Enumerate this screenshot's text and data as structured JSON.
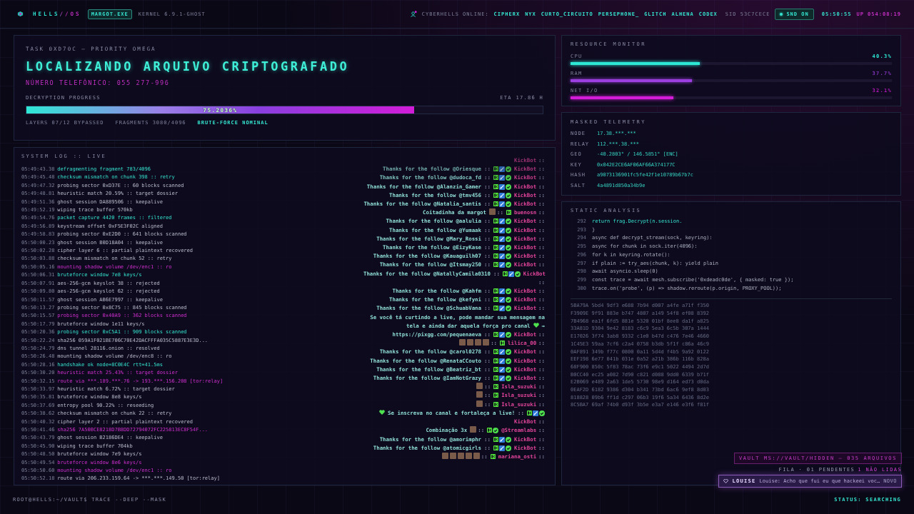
{
  "top_bar": {
    "brand": "HELLS//OS",
    "process": "MARGOT.EXE",
    "kernel": "KERNEL 6.9.1-GHOST",
    "online_label": "CYBERHELLS ONLINE:",
    "online_users": [
      "CIPHERX",
      "NYX",
      "CURTO_CIRCUITO",
      "PERSEPHONE_",
      "GLITCH",
      "ALHENA",
      "CODEX"
    ],
    "sid": "SID 53C7CECE",
    "sound": {
      "label": "SND ON",
      "on": true
    },
    "clock": "05:50:55",
    "uptime": "UP 054:08:19"
  },
  "task": {
    "label": "TASK 0XD70C — PRIORITY OMEGA",
    "title": "LOCALIZANDO ARQUIVO CRIPTOGRAFADO",
    "phone": "NÚMERO TELEFÔNICO: 055 277-996",
    "progress_label": "DECRYPTION PROGRESS",
    "eta": "ETA 17.86 H",
    "progress": {
      "level": 0.751,
      "reading": "75.2036%"
    },
    "stats": [
      {
        "text": "LAYERS 07/12 BYPASSED",
        "kind": "plain"
      },
      {
        "text": "FRAGMENTS 3080/4096",
        "kind": "plain"
      },
      {
        "text": "BRUTE-FORCE NOMINAL",
        "kind": "ok"
      }
    ]
  },
  "system_log": {
    "title": "SYSTEM LOG :: LIVE",
    "lines": [
      {
        "time": "05:49:43.38",
        "text": "defragmenting fragment 783/4096",
        "kind": "ok"
      },
      {
        "time": "05:49:45.48",
        "text": "checksum mismatch on chunk 398 :: retry",
        "kind": "ok"
      },
      {
        "time": "05:49:47.32",
        "text": "probing sector 0xD37E :: 60 blocks scanned",
        "kind": "plain"
      },
      {
        "time": "05:49:48.81",
        "text": "heuristic match 20.59% :: target dossier",
        "kind": "plain"
      },
      {
        "time": "05:49:51.36",
        "text": "ghost session DA889506 :: keepalive",
        "kind": "plain"
      },
      {
        "time": "05:49:52.19",
        "text": "wiping trace buffer 570kb",
        "kind": "plain"
      },
      {
        "time": "05:49:54.76",
        "text": "packet capture 4420 frames :: filtered",
        "kind": "ok"
      },
      {
        "time": "05:49:56.89",
        "text": "keystream offset 0xF5E3F02C aligned",
        "kind": "plain"
      },
      {
        "time": "05:49:58.83",
        "text": "probing sector 0xE2D0 :: 641 blocks scanned",
        "kind": "plain"
      },
      {
        "time": "05:50:00.23",
        "text": "ghost session B0D18A04 :: keepalive",
        "kind": "plain"
      },
      {
        "time": "05:50:02.28",
        "text": "cipher layer 6 :: partial plaintext recovered",
        "kind": "plain"
      },
      {
        "time": "05:50:03.88",
        "text": "checksum mismatch on chunk 52 :: retry",
        "kind": "plain"
      },
      {
        "time": "05:50:05.16",
        "text": "mounting shadow volume /dev/enc1 :: ro",
        "kind": "alert"
      },
      {
        "time": "05:50:06.31",
        "text": "bruteforce window 7e8 keys/s",
        "kind": "ok"
      },
      {
        "time": "05:50:07.91",
        "text": "aes-256-gcm keyslot 38 :: rejected",
        "kind": "plain"
      },
      {
        "time": "05:50:09.80",
        "text": "aes-256-gcm keyslot 62 :: rejected",
        "kind": "plain"
      },
      {
        "time": "05:50:11.57",
        "text": "ghost session AB6E7997 :: keepalive",
        "kind": "plain"
      },
      {
        "time": "05:50:13.27",
        "text": "probing sector 0x8C75 :: 845 blocks scanned",
        "kind": "plain"
      },
      {
        "time": "05:50:15.57",
        "text": "probing sector 0x40A9 :: 362 blocks scanned",
        "kind": "alert"
      },
      {
        "time": "05:50:17.79",
        "text": "bruteforce window 1e11 keys/s",
        "kind": "plain"
      },
      {
        "time": "05:50:20.36",
        "text": "probing sector 0xC5A1 :: 909 blocks scanned",
        "kind": "ok"
      },
      {
        "time": "05:50:22.24",
        "text": "sha256 059A1F021BE706C70E42DACFFFA035C5887E3E3D...",
        "kind": "plain"
      },
      {
        "time": "05:50:24.79",
        "text": "dns tunnel 28116.onion :: resolved",
        "kind": "plain"
      },
      {
        "time": "05:50:26.48",
        "text": "mounting shadow volume /dev/enc8 :: ro",
        "kind": "plain"
      },
      {
        "time": "05:50:28.16",
        "text": "handshake ok node=8C0E4C rtt=41.5ms",
        "kind": "ok"
      },
      {
        "time": "05:50:30.20",
        "text": "heuristic match 25.43% :: target dossier",
        "kind": "alert"
      },
      {
        "time": "05:50:32.15",
        "text": "route via ***.189.***.76 -> 193.***.156.208 [tor:relay]",
        "kind": "alert"
      },
      {
        "time": "05:50:33.97",
        "text": "heuristic match 6.72% :: target dossier",
        "kind": "plain"
      },
      {
        "time": "05:50:35.81",
        "text": "bruteforce window 8e8 keys/s",
        "kind": "plain"
      },
      {
        "time": "05:50:37.69",
        "text": "entropy pool 90.22% :: reseeding",
        "kind": "plain"
      },
      {
        "time": "05:50:38.62",
        "text": "checksum mismatch on chunk 22 :: retry",
        "kind": "plain"
      },
      {
        "time": "05:50:40.32",
        "text": "cipher layer 2 :: partial plaintext recovered",
        "kind": "plain"
      },
      {
        "time": "05:50:41.46",
        "text": "sha256 7A50BCE8218D7B8DD72794072FC225813EC8F54F...",
        "kind": "alert"
      },
      {
        "time": "05:50:43.79",
        "text": "ghost session B2186DE4 :: keepalive",
        "kind": "plain"
      },
      {
        "time": "05:50:45.90",
        "text": "wiping trace buffer 704kb",
        "kind": "plain"
      },
      {
        "time": "05:50:48.50",
        "text": "bruteforce window 7e9 keys/s",
        "kind": "plain"
      },
      {
        "time": "05:50:49.54",
        "text": "bruteforce window 8e6 keys/s",
        "kind": "alert"
      },
      {
        "time": "05:50:50.60",
        "text": "mounting shadow volume /dev/enc1 :: ro",
        "kind": "alert"
      },
      {
        "time": "05:50:52.18",
        "text": "route via 206.233.159.64 -> ***.***.149.50 [tor:relay]",
        "kind": "plain"
      }
    ]
  },
  "chat": [
    {
      "user": "KickBot",
      "tail": "::"
    },
    {
      "parts": [
        {
          "kind": "text",
          "text": "Thanks for the follow @Oriesque"
        },
        {
          "kind": "sep",
          "text": "::"
        }
      ],
      "badges": [
        {
          "kind": "kick"
        },
        {
          "kind": "sword"
        },
        {
          "kind": "verified"
        }
      ],
      "user": "KickBot",
      "tail": "::"
    },
    {
      "parts": [
        {
          "kind": "text",
          "text": "Thanks for the follow @dudoca_fd"
        },
        {
          "kind": "sep",
          "text": "::"
        }
      ],
      "badges": [
        {
          "kind": "kick"
        },
        {
          "kind": "sword"
        },
        {
          "kind": "verified"
        }
      ],
      "user": "KickBot",
      "tail": "::"
    },
    {
      "parts": [
        {
          "kind": "text",
          "text": "Thanks for the follow @Alanzin_Gamer"
        },
        {
          "kind": "sep",
          "text": "::"
        }
      ],
      "badges": [
        {
          "kind": "kick"
        },
        {
          "kind": "sword"
        },
        {
          "kind": "verified"
        }
      ],
      "user": "KickBot",
      "tail": "::"
    },
    {
      "parts": [
        {
          "kind": "text",
          "text": "Thanks for the follow @tmv456"
        },
        {
          "kind": "sep",
          "text": "::"
        }
      ],
      "badges": [
        {
          "kind": "kick"
        },
        {
          "kind": "sword"
        },
        {
          "kind": "verified"
        }
      ],
      "user": "KickBot",
      "tail": "::"
    },
    {
      "parts": [
        {
          "kind": "text",
          "text": "Thanks for the follow @Natalia_santis"
        },
        {
          "kind": "sep",
          "text": "::"
        }
      ],
      "badges": [
        {
          "kind": "kick"
        },
        {
          "kind": "sword"
        },
        {
          "kind": "verified"
        }
      ],
      "user": "KickBot",
      "tail": "::"
    },
    {
      "parts": [
        {
          "kind": "text",
          "text": "Coitadinha da margot"
        },
        {
          "kind": "emote"
        },
        {
          "kind": "sep",
          "text": "::"
        }
      ],
      "badges": [
        {
          "kind": "kick"
        }
      ],
      "user": "buenosn",
      "tail": "::"
    },
    {
      "parts": [
        {
          "kind": "text",
          "text": "Thanks for the follow @aalulia"
        },
        {
          "kind": "sep",
          "text": "::"
        }
      ],
      "badges": [
        {
          "kind": "kick"
        },
        {
          "kind": "sword"
        },
        {
          "kind": "verified"
        }
      ],
      "user": "KickBot",
      "tail": "::"
    },
    {
      "parts": [
        {
          "kind": "text",
          "text": "Thanks for the follow @Yumaak"
        },
        {
          "kind": "sep",
          "text": "::"
        }
      ],
      "badges": [
        {
          "kind": "kick"
        },
        {
          "kind": "sword"
        },
        {
          "kind": "verified"
        }
      ],
      "user": "KickBot",
      "tail": "::"
    },
    {
      "parts": [
        {
          "kind": "text",
          "text": "Thanks for the follow @Mary_Rossi"
        },
        {
          "kind": "sep",
          "text": "::"
        }
      ],
      "badges": [
        {
          "kind": "kick"
        },
        {
          "kind": "sword"
        },
        {
          "kind": "verified"
        }
      ],
      "user": "KickBot",
      "tail": "::"
    },
    {
      "parts": [
        {
          "kind": "text",
          "text": "Thanks for the follow @EizyKase"
        },
        {
          "kind": "sep",
          "text": "::"
        }
      ],
      "badges": [
        {
          "kind": "kick"
        },
        {
          "kind": "sword"
        },
        {
          "kind": "verified"
        }
      ],
      "user": "KickBot",
      "tail": "::"
    },
    {
      "parts": [
        {
          "kind": "text",
          "text": "Thanks for the follow @Kauaguilh07"
        },
        {
          "kind": "sep",
          "text": "::"
        }
      ],
      "badges": [
        {
          "kind": "kick"
        },
        {
          "kind": "sword"
        },
        {
          "kind": "verified"
        }
      ],
      "user": "KickBot",
      "tail": "::"
    },
    {
      "parts": [
        {
          "kind": "text",
          "text": "Thanks for the follow @Itsmay250"
        },
        {
          "kind": "sep",
          "text": "::"
        }
      ],
      "badges": [
        {
          "kind": "kick"
        },
        {
          "kind": "sword"
        },
        {
          "kind": "verified"
        }
      ],
      "user": "KickBot",
      "tail": "::"
    },
    {
      "parts": [
        {
          "kind": "text",
          "text": "Thanks for the follow @NatallyCamila0310"
        },
        {
          "kind": "sep",
          "text": "::"
        }
      ],
      "badges": [
        {
          "kind": "kick"
        },
        {
          "kind": "sword"
        },
        {
          "kind": "verified"
        }
      ],
      "user": "KickBot",
      "tail": "::"
    },
    {
      "parts": [
        {
          "kind": "text",
          "text": "Thanks for the follow @Kahfm"
        },
        {
          "kind": "sep",
          "text": "::"
        }
      ],
      "badges": [
        {
          "kind": "kick"
        },
        {
          "kind": "sword"
        },
        {
          "kind": "verified"
        }
      ],
      "user": "KickBot",
      "tail": "::"
    },
    {
      "parts": [
        {
          "kind": "text",
          "text": "Thanks for the follow @kefyni"
        },
        {
          "kind": "sep",
          "text": "::"
        }
      ],
      "badges": [
        {
          "kind": "kick"
        },
        {
          "kind": "sword"
        },
        {
          "kind": "verified"
        }
      ],
      "user": "KickBot",
      "tail": "::"
    },
    {
      "parts": [
        {
          "kind": "text",
          "text": "Thanks for the follow @SchuabVana"
        },
        {
          "kind": "sep",
          "text": "::"
        }
      ],
      "badges": [
        {
          "kind": "kick"
        },
        {
          "kind": "sword"
        },
        {
          "kind": "verified"
        }
      ],
      "user": "KickBot",
      "tail": "::"
    },
    {
      "parts": [
        {
          "kind": "text",
          "text": "Se você tá curtindo a live, pode mandar sua mensagem na"
        },
        {
          "kind": "text",
          "text": "tela e ainda dar aquela força pro canal"
        },
        {
          "kind": "heart"
        },
        {
          "kind": "text",
          "text": "→"
        },
        {
          "kind": "text",
          "text": "https://pixgg.com/pequenaeva"
        },
        {
          "kind": "sep",
          "text": "::"
        }
      ],
      "badges": [
        {
          "kind": "kick"
        },
        {
          "kind": "sword"
        },
        {
          "kind": "verified"
        }
      ],
      "user": "KickBot",
      "tail": "::"
    },
    {
      "parts": [
        {
          "kind": "emote"
        },
        {
          "kind": "emote"
        },
        {
          "kind": "emote"
        },
        {
          "kind": "emote"
        },
        {
          "kind": "sep",
          "text": "::"
        }
      ],
      "badges": [
        {
          "kind": "kick"
        }
      ],
      "user": "lilica_00",
      "tail": "::"
    },
    {
      "parts": [
        {
          "kind": "text",
          "text": "Thanks for the follow @carol0278"
        },
        {
          "kind": "sep",
          "text": "::"
        }
      ],
      "badges": [
        {
          "kind": "kick"
        },
        {
          "kind": "sword"
        },
        {
          "kind": "verified"
        }
      ],
      "user": "KickBot",
      "tail": "::"
    },
    {
      "parts": [
        {
          "kind": "text",
          "text": "Thanks for the follow @RenataCCouto"
        },
        {
          "kind": "sep",
          "text": "::"
        }
      ],
      "badges": [
        {
          "kind": "kick"
        },
        {
          "kind": "sword"
        },
        {
          "kind": "verified"
        }
      ],
      "user": "KickBot",
      "tail": "::"
    },
    {
      "parts": [
        {
          "kind": "text",
          "text": "Thanks for the follow @Beatriz_bt"
        },
        {
          "kind": "sep",
          "text": "::"
        }
      ],
      "badges": [
        {
          "kind": "kick"
        },
        {
          "kind": "sword"
        },
        {
          "kind": "verified"
        }
      ],
      "user": "KickBot",
      "tail": "::"
    },
    {
      "parts": [
        {
          "kind": "text",
          "text": "Thanks for the follow @IamNotGrazy"
        },
        {
          "kind": "sep",
          "text": "::"
        }
      ],
      "badges": [
        {
          "kind": "kick"
        },
        {
          "kind": "sword"
        },
        {
          "kind": "verified"
        }
      ],
      "user": "KickBot",
      "tail": "::"
    },
    {
      "parts": [
        {
          "kind": "emote"
        },
        {
          "kind": "sep",
          "text": "::"
        }
      ],
      "badges": [
        {
          "kind": "kick"
        }
      ],
      "user": "Isla_suzuki",
      "tail": "::"
    },
    {
      "parts": [
        {
          "kind": "emote"
        },
        {
          "kind": "sep",
          "text": "::"
        }
      ],
      "badges": [
        {
          "kind": "kick"
        }
      ],
      "user": "Isla_suzuki",
      "tail": "::"
    },
    {
      "parts": [
        {
          "kind": "emote"
        },
        {
          "kind": "sep",
          "text": "::"
        }
      ],
      "badges": [
        {
          "kind": "kick"
        }
      ],
      "user": "Isla_suzuki",
      "tail": "::"
    },
    {
      "parts": [
        {
          "kind": "heart"
        },
        {
          "kind": "text",
          "text": "Se inscreva no canal e fortaleça a live!"
        },
        {
          "kind": "sep",
          "text": "::"
        }
      ],
      "badges": [
        {
          "kind": "kick"
        },
        {
          "kind": "sword"
        },
        {
          "kind": "verified"
        }
      ],
      "user": "KickBot",
      "tail": "::"
    },
    {
      "parts": [
        {
          "kind": "text",
          "text": "Combinação 3x"
        },
        {
          "kind": "emote"
        },
        {
          "kind": "sep",
          "text": "::"
        }
      ],
      "badges": [
        {
          "kind": "kick"
        },
        {
          "kind": "verified"
        }
      ],
      "user": "@Streamlabs",
      "tail": "::"
    },
    {
      "parts": [
        {
          "kind": "text",
          "text": "Thanks for the follow @amorimphr"
        },
        {
          "kind": "sep",
          "text": "::"
        }
      ],
      "badges": [
        {
          "kind": "kick"
        },
        {
          "kind": "sword"
        },
        {
          "kind": "verified"
        }
      ],
      "user": "KickBot",
      "tail": "::"
    },
    {
      "parts": [
        {
          "kind": "text",
          "text": "Thanks for the follow @atomicgirls"
        },
        {
          "kind": "sep",
          "text": "::"
        }
      ],
      "badges": [
        {
          "kind": "kick"
        },
        {
          "kind": "sword"
        },
        {
          "kind": "verified"
        }
      ],
      "user": "KickBot",
      "tail": "::"
    },
    {
      "parts": [
        {
          "kind": "emote"
        },
        {
          "kind": "emote"
        },
        {
          "kind": "emote"
        },
        {
          "kind": "emote"
        },
        {
          "kind": "emote"
        },
        {
          "kind": "sep",
          "text": "::"
        }
      ],
      "badges": [
        {
          "kind": "kick"
        }
      ],
      "user": "mariana_osti",
      "tail": "::"
    }
  ],
  "resource_monitor": {
    "title": "RESOURCE MONITOR",
    "meters": [
      {
        "label": "CPU",
        "reading": "40.3%",
        "level": 0.403,
        "color": "#2ee8d6"
      },
      {
        "label": "RAM",
        "reading": "37.7%",
        "level": 0.377,
        "color": "#9b3fe0"
      },
      {
        "label": "NET I/O",
        "reading": "32.1%",
        "level": 0.321,
        "color": "#d21cd8"
      }
    ]
  },
  "telemetry": {
    "title": "MASKED TELEMETRY",
    "rows": [
      {
        "key": "NODE",
        "value": "17.38.***.***"
      },
      {
        "key": "RELAY",
        "value": "112.***.38.***"
      },
      {
        "key": "GEO",
        "value": "-40.2803° / 146.5851° [ENC]"
      },
      {
        "key": "KEY",
        "value": "0x042E2CE6AF06AF66A374177C"
      },
      {
        "key": "HASH",
        "value": "a9073136901fc5fe42f1e10789b67b7c"
      },
      {
        "key": "SALT",
        "value": "4a4891d850a34b9e"
      }
    ]
  },
  "static_analysis": {
    "title": "STATIC ANALYSIS",
    "code": [
      {
        "number": "292",
        "text": "return frag.Decrypt(n.session.",
        "highlighted": true
      },
      {
        "number": "293",
        "text": "}",
        "highlighted": false
      },
      {
        "number": "294",
        "text": "async def decrypt_stream(sock, keyring):",
        "highlighted": false
      },
      {
        "number": "295",
        "text": "async for chunk in sock.iter(4096):",
        "highlighted": false
      },
      {
        "number": "296",
        "text": "for k in keyring.rotate():",
        "highlighted": false
      },
      {
        "number": "297",
        "text": "if plain := try_aes(chunk, k): yield plain",
        "highlighted": false
      },
      {
        "number": "298",
        "text": "await asyncio.sleep(0)",
        "highlighted": false
      },
      {
        "number": "299",
        "text": "const trace = await mesh.subscribe('0xdeadc0de', { masked: true });",
        "highlighted": false
      },
      {
        "number": "300",
        "text": "trace.on('probe', (p) => shadow.reroute(p.origin, PROXY_POOL));",
        "highlighted": false
      }
    ],
    "hex_dump": [
      "5BA79A 5bd4 9df3 e688 7b94 d007 a4fe a71f f350",
      "F3909E 9f91 883e b747 4807 a149 54f8 ef08 8392",
      "7B4968 ea1f 6fd5 881e 5320 01bf 8ee8 da1f a825",
      "33A81D 9304 9e42 8183 c6c9 5ea3 6c5b 307a 1444",
      "E17026 3f74 3ab8 9332 c1e0 b47d c476 7e46 4660",
      "1C45E3 59aa 7cf6 c2a4 0758 b3db 5f1f c86a 46c9",
      "0AF891 349b f77c 0800 0a11 5d4d f4b5 9a92 0122",
      "EEF198 6e77 041b 031e 0a52 a21b 386b 116b 828a",
      "68F900 850c 5f83 78ac 73f6 e9c1 5022 4494 2d7d",
      "B0CC40 ec25 a082 7d90 c821 d088 9dd0 6339 b71f",
      "E2B069 e489 2a63 1de5 5730 98e9 d164 ed73 d0da",
      "0EAF2D 6182 9386 d304 b341 73bd 6ac6 9ef8 8d03",
      "818828 09b6 ff1d c297 06b3 19f6 5a34 6436 8d2e",
      "8C5BA7 69af 74b0 d93f 3b5e e3a7 e146 e3f6 f81f"
    ]
  },
  "notifications": {
    "vault": "VAULT MS://VAULT/HIDDEN — 035 ARQUIVOS",
    "queue": "FILA · 01 PENDENTES",
    "unread": "1 NÃO LIDAS",
    "toast": {
      "sender": "LOUISE",
      "message": "Louise: Acho que fui eu que hackeei voc…",
      "tag": "NOVO"
    }
  },
  "bottom_bar": {
    "prompt": "ROOT@HELLS:~/VAULT$ TRACE --DEEP --MASK",
    "status": "STATUS: SEARCHING"
  }
}
